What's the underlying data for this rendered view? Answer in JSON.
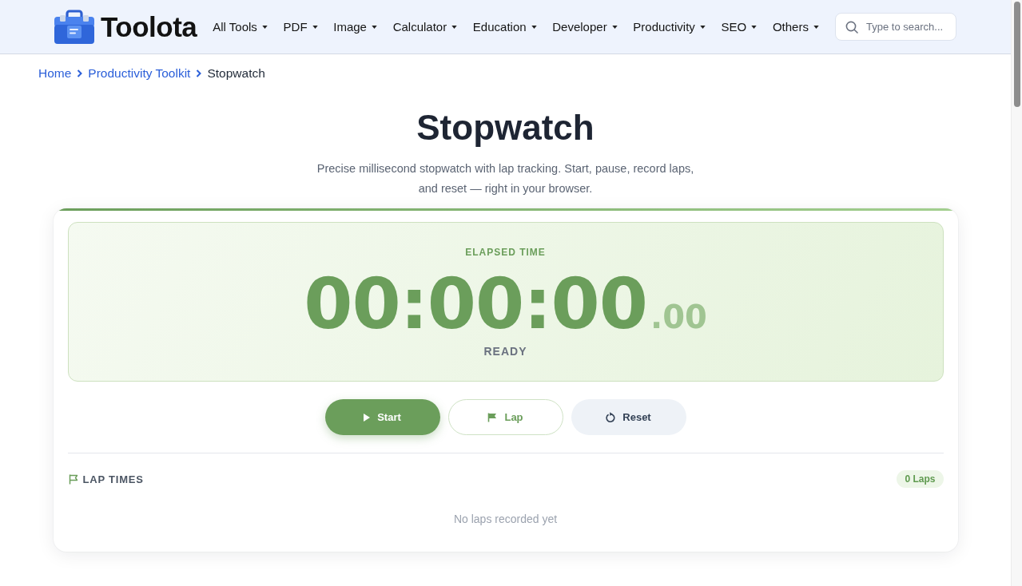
{
  "header": {
    "logo": {
      "text": "Toolota"
    },
    "nav": [
      {
        "label": "All Tools"
      },
      {
        "label": "PDF"
      },
      {
        "label": "Image"
      },
      {
        "label": "Calculator"
      },
      {
        "label": "Education"
      },
      {
        "label": "Developer"
      },
      {
        "label": "Productivity"
      },
      {
        "label": "SEO"
      },
      {
        "label": "Others"
      }
    ],
    "search": {
      "placeholder": "Type to search..."
    }
  },
  "breadcrumb": [
    {
      "label": "Home",
      "kind": "link"
    },
    {
      "label": "Productivity Toolkit",
      "kind": "link"
    },
    {
      "label": "Stopwatch",
      "kind": "current"
    }
  ],
  "title": "Stopwatch",
  "description": "Precise millisecond stopwatch with lap tracking. Start, pause, record laps, and reset — right in your browser.",
  "stopwatch": {
    "display_label": "ELAPSED TIME",
    "time": "00:00:00",
    "fraction": ".00",
    "status": "READY",
    "buttons": [
      {
        "label": "Start",
        "kind": "primary"
      },
      {
        "label": "Lap",
        "kind": "outline"
      },
      {
        "label": "Reset",
        "kind": "secondary"
      }
    ]
  },
  "laps": {
    "heading": "LAP TIMES",
    "count": "0 Laps",
    "empty_message": "No laps recorded yet"
  }
}
